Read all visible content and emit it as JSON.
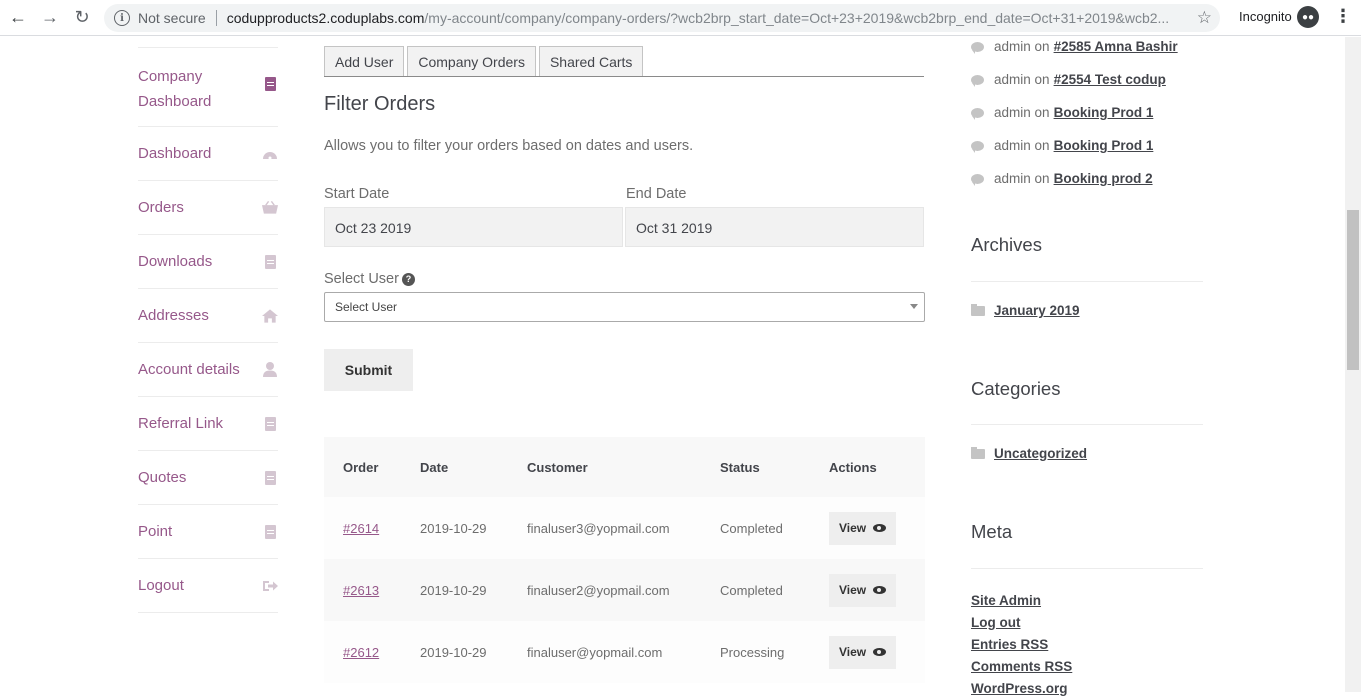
{
  "browser": {
    "not_secure": "Not secure",
    "host": "codupproducts2.coduplabs.com",
    "path": "/my-account/company/company-orders/?wcb2brp_start_date=Oct+23+2019&wcb2brp_end_date=Oct+31+2019&wcb2...",
    "incognito": "Incognito"
  },
  "leftnav": {
    "items": [
      {
        "label": "Company Dashboard"
      },
      {
        "label": "Dashboard"
      },
      {
        "label": "Orders"
      },
      {
        "label": "Downloads"
      },
      {
        "label": "Addresses"
      },
      {
        "label": "Account details"
      },
      {
        "label": "Referral Link"
      },
      {
        "label": "Quotes"
      },
      {
        "label": "Point"
      },
      {
        "label": "Logout"
      }
    ]
  },
  "tabs": [
    "Add User",
    "Company Orders",
    "Shared Carts"
  ],
  "filter": {
    "title": "Filter Orders",
    "description": "Allows you to filter your orders based on dates and users.",
    "start_label": "Start Date",
    "start_value": "Oct 23 2019",
    "end_label": "End Date",
    "end_value": "Oct 31 2019",
    "user_label": "Select User",
    "user_help": "?",
    "user_value": "Select User",
    "submit": "Submit"
  },
  "orders": {
    "headers": [
      "Order",
      "Date",
      "Customer",
      "Status",
      "Actions"
    ],
    "rows": [
      {
        "order": "#2614",
        "date": "2019-10-29",
        "customer": "finaluser3@yopmail.com",
        "status": "Completed",
        "action": "View"
      },
      {
        "order": "#2613",
        "date": "2019-10-29",
        "customer": "finaluser2@yopmail.com",
        "status": "Completed",
        "action": "View"
      },
      {
        "order": "#2612",
        "date": "2019-10-29",
        "customer": "finaluser@yopmail.com",
        "status": "Processing",
        "action": "View"
      }
    ]
  },
  "sidebar": {
    "comments": [
      {
        "author": "admin",
        "on": "on",
        "post": "#2585 Amna Bashir"
      },
      {
        "author": "admin",
        "on": "on",
        "post": "#2554 Test codup"
      },
      {
        "author": "admin",
        "on": "on",
        "post": "Booking Prod 1"
      },
      {
        "author": "admin",
        "on": "on",
        "post": "Booking Prod 1"
      },
      {
        "author": "admin",
        "on": "on",
        "post": "Booking prod 2"
      }
    ],
    "archives_title": "Archives",
    "archive_item": "January 2019",
    "categories_title": "Categories",
    "category_item": "Uncategorized",
    "meta_title": "Meta",
    "meta_links": [
      "Site Admin",
      "Log out",
      "Entries RSS",
      "Comments RSS",
      "WordPress.org"
    ]
  }
}
